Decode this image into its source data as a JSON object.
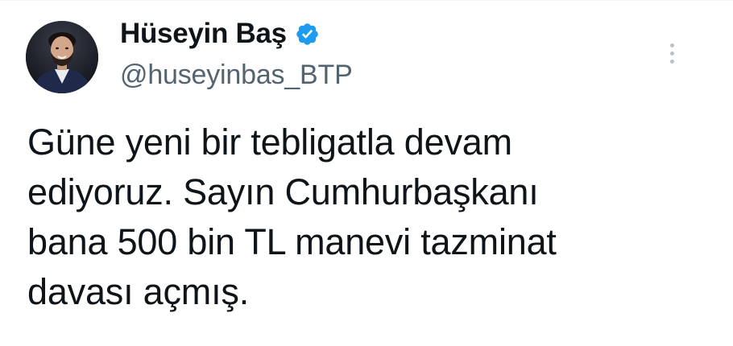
{
  "author": {
    "display_name": "Hüseyin Baş",
    "handle": "@huseyinbas_BTP",
    "verified": true
  },
  "tweet": {
    "lines": [
      "Güne yeni bir tebligatla devam",
      "ediyoruz. Sayın Cumhurbaşkanı",
      "bana 500 bin TL manevi tazminat",
      "davası açmış."
    ]
  },
  "icons": {
    "verified": "verified-badge-icon",
    "more": "more-options-icon"
  },
  "colors": {
    "text": "#0f1419",
    "handle": "#536471",
    "verified_badge": "#1d9bf0",
    "more_dots": "#b9c0c6"
  }
}
